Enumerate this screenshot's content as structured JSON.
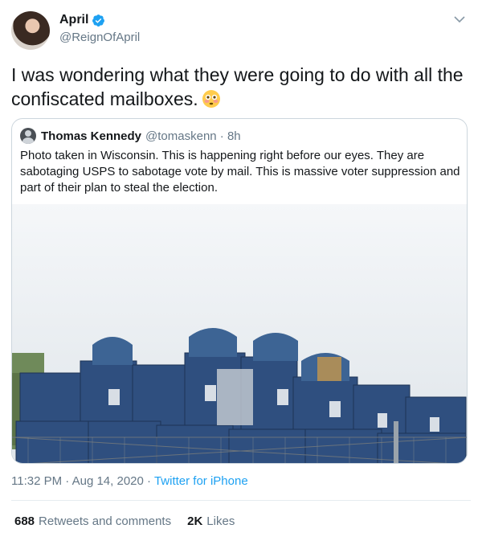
{
  "author": {
    "name": "April",
    "handle": "@ReignOfApril",
    "verified_icon": "verified-badge-icon",
    "avatar_icon": "avatar"
  },
  "tweet": {
    "text": "I was wondering what they were going to do with all the confiscated mailboxes.",
    "emoji_icon": "flushed-face-emoji"
  },
  "quote": {
    "name": "Thomas Kennedy",
    "handle": "@tomaskenn · 8h",
    "text": "Photo taken in Wisconsin. This is happening right before our eyes. They are sabotaging USPS to sabotage vote by mail. This is massive voter suppression and part of their plan to steal the election."
  },
  "meta": {
    "time": "11:32 PM",
    "date": "Aug 14, 2020",
    "source": "Twitter for iPhone"
  },
  "stats": {
    "retweets_count": "688",
    "retweets_label": "Retweets and comments",
    "likes_count": "2K",
    "likes_label": "Likes"
  },
  "colors": {
    "accent": "#1da1f2",
    "text": "#14171a",
    "muted": "#657786",
    "border": "#ccd6dd",
    "mailbox_blue": "#2f4f7f"
  }
}
